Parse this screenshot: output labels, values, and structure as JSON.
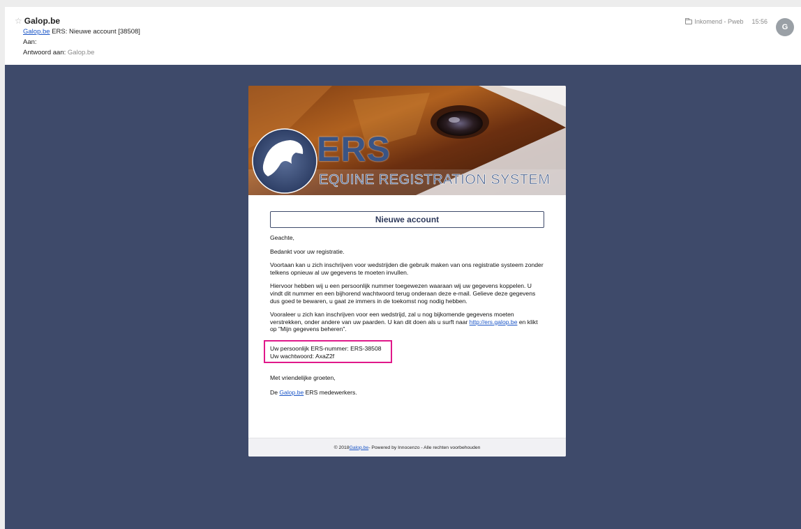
{
  "header": {
    "sender": "Galop.be",
    "subject_link": "Galop.be",
    "subject_rest": " ERS: Nieuwe account [38508]",
    "to_label": "Aan:",
    "reply_label": "Antwoord aan:",
    "reply_value": "Galop.be",
    "folder": "Inkomend - Pweb",
    "time": "15:56",
    "avatar_initial": "G"
  },
  "banner": {
    "logo_text": "ERS",
    "logo_subtitle": "EQUINE REGISTRATION SYSTEM"
  },
  "email": {
    "title": "Nieuwe account",
    "greeting": "Geachte,",
    "p1": "Bedankt voor uw registratie.",
    "p2": "Voortaan kan u zich inschrijven voor wedstrijden die gebruik maken van ons registratie systeem zonder telkens opnieuw al uw gegevens te moeten invullen.",
    "p3": "Hiervoor hebben wij u een persoonlijk nummer toegewezen waaraan wij uw gegevens koppelen. U vindt dit nummer en een bijhorend wachtwoord terug onderaan deze e-mail. Gelieve deze gegevens dus goed te bewaren, u gaat ze immers in de toekomst nog nodig hebben.",
    "p4_before": "Vooraleer u zich kan inschrijven voor een wedstrijd, zal u nog bijkomende gegevens moeten verstrekken, onder andere van uw paarden. U kan dit doen als u surft naar ",
    "p4_link": "http://ers.galop.be",
    "p4_after": " en klikt op \"Mijn gegevens beheren\".",
    "ers_number": "Uw persoonlijk ERS-nummer: ERS-38508",
    "password": "Uw wachtwoord: AxaZ2f",
    "closing": "Met vriendelijke groeten,",
    "signoff_before": "De ",
    "signoff_link": "Galop.be",
    "signoff_after": " ERS medewerkers."
  },
  "footer": {
    "before": "© 2018 ",
    "link": "Galop.be",
    "after": " - Powered by Innocenzo - Alle rechten voorbehouden"
  },
  "colors": {
    "body_bg": "#3e4a6a",
    "highlight": "#e0188a",
    "link": "#1a55c7",
    "brand_blue": "#3a5484"
  }
}
